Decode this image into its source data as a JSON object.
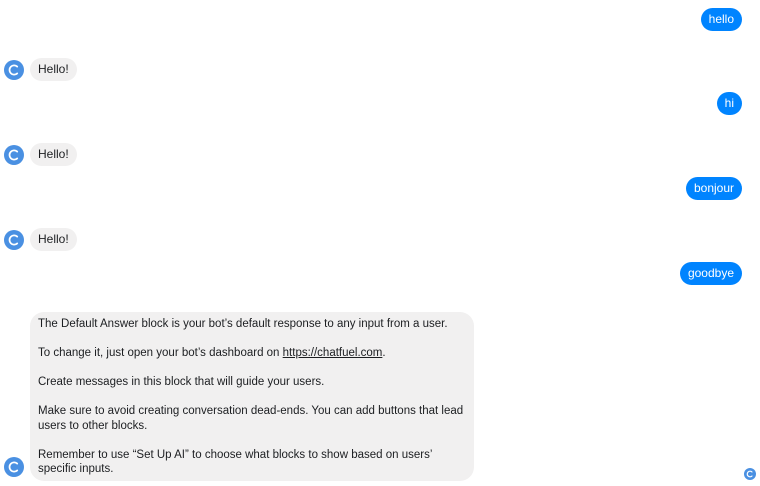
{
  "messages": [
    {
      "sender": "user",
      "text": "hello"
    },
    {
      "sender": "bot",
      "text": "Hello!"
    },
    {
      "sender": "user",
      "text": "hi"
    },
    {
      "sender": "bot",
      "text": "Hello!"
    },
    {
      "sender": "user",
      "text": "bonjour"
    },
    {
      "sender": "bot",
      "text": "Hello!"
    },
    {
      "sender": "user",
      "text": "goodbye"
    }
  ],
  "default_answer": {
    "p1": "The Default Answer block is your bot’s default response to any input from a user.",
    "p2_prefix": "To change it, just open your bot’s dashboard on ",
    "p2_link": "https://chatfuel.com",
    "p2_suffix": ".",
    "p3": "Create messages in this block that will guide your users.",
    "p4": "Make sure to avoid creating conversation dead-ends. You can add buttons that lead users to other blocks.",
    "p5": "Remember to use “Set Up AI” to choose what blocks to show based on users’ specific inputs."
  },
  "colors": {
    "user_bubble": "#0084ff",
    "bot_bubble": "#f1f0f0",
    "avatar": "#4a90e2"
  },
  "icons": {
    "bot_avatar": "chatfuel-logo-icon",
    "seen_indicator": "seen-avatar-icon"
  }
}
